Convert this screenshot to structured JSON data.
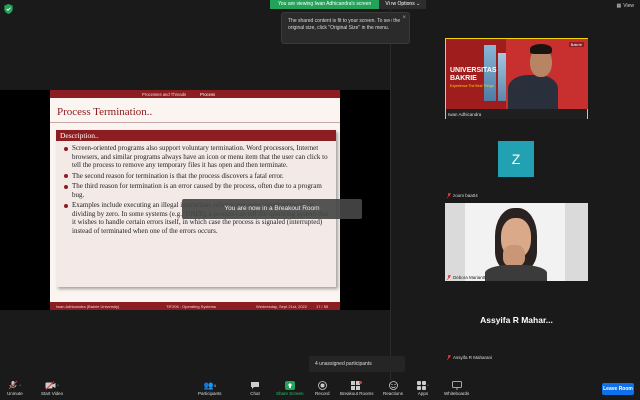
{
  "header": {
    "viewing_text": "You are viewing Iwan Adhicandra's screen",
    "view_options": "View Options",
    "view_label": "View"
  },
  "tooltip": {
    "text": "The shared content is fit to your screen. To see the original size, click \"Original Size\" in the menu."
  },
  "slide": {
    "top_nav_left": "Processes and Threads",
    "top_nav_right": "Process",
    "title": "Process Termination..",
    "section_head": "Description..",
    "bullets": [
      "Screen-oriented programs also support voluntary termination. Word processors, Internet browsers, and similar programs always have an icon or menu item that the user can click to tell the process to remove any temporary files it has open and then terminate.",
      "The second reason for termination is that the process discovers a fatal error.",
      "The third reason for termination is an error caused by the process, often due to a program bug.",
      "Examples include executing an illegal instruction, referencing nonexistent memory, or dividing by zero. In some systems (e.g., UNIX), a process can tell the operating system that it wishes to handle certain errors itself, in which case the process is signaled (interrupted) instead of terminated when one of the errors occurs."
    ],
    "footer_author": "Iwan Adhicandra (Bakrie University)",
    "footer_course": "TIF206 : Operating Systems",
    "footer_date": "Wednesday, Sept 21st, 2022",
    "footer_page": "17 / 55"
  },
  "breakout_text": "You are now in a Breakout Room",
  "participants": {
    "tile1": {
      "name": "Iwan Adhicandra",
      "logo_line1": "UNIVERSITAS",
      "logo_line2": "BAKRIE",
      "tagline": "Experience The Best Things",
      "badge": "Bakrie"
    },
    "tile2": {
      "name": "zoom baa04",
      "initial": "Z"
    },
    "tile3": {
      "name": "Debora Mariantti"
    },
    "tile4": {
      "display": "Assyifa R Mahar...",
      "name": "Assyifa R Maharani"
    }
  },
  "unassigned": "4 unassigned participants",
  "toolbar": {
    "unmute": "Unmute",
    "start_video": "Start Video",
    "participants": "Participants",
    "participants_count": "4",
    "chat": "Chat",
    "share_screen": "Share Screen",
    "record": "Record",
    "breakout_rooms": "Breakout Rooms",
    "reactions": "Reactions",
    "apps": "Apps",
    "whiteboards": "Whiteboards",
    "leave": "Leave Room"
  },
  "colors": {
    "zoom_green": "#25a25a",
    "slide_accent": "#8c1d20",
    "leave_blue": "#0e71eb",
    "avatar_teal": "#22a1b3"
  }
}
